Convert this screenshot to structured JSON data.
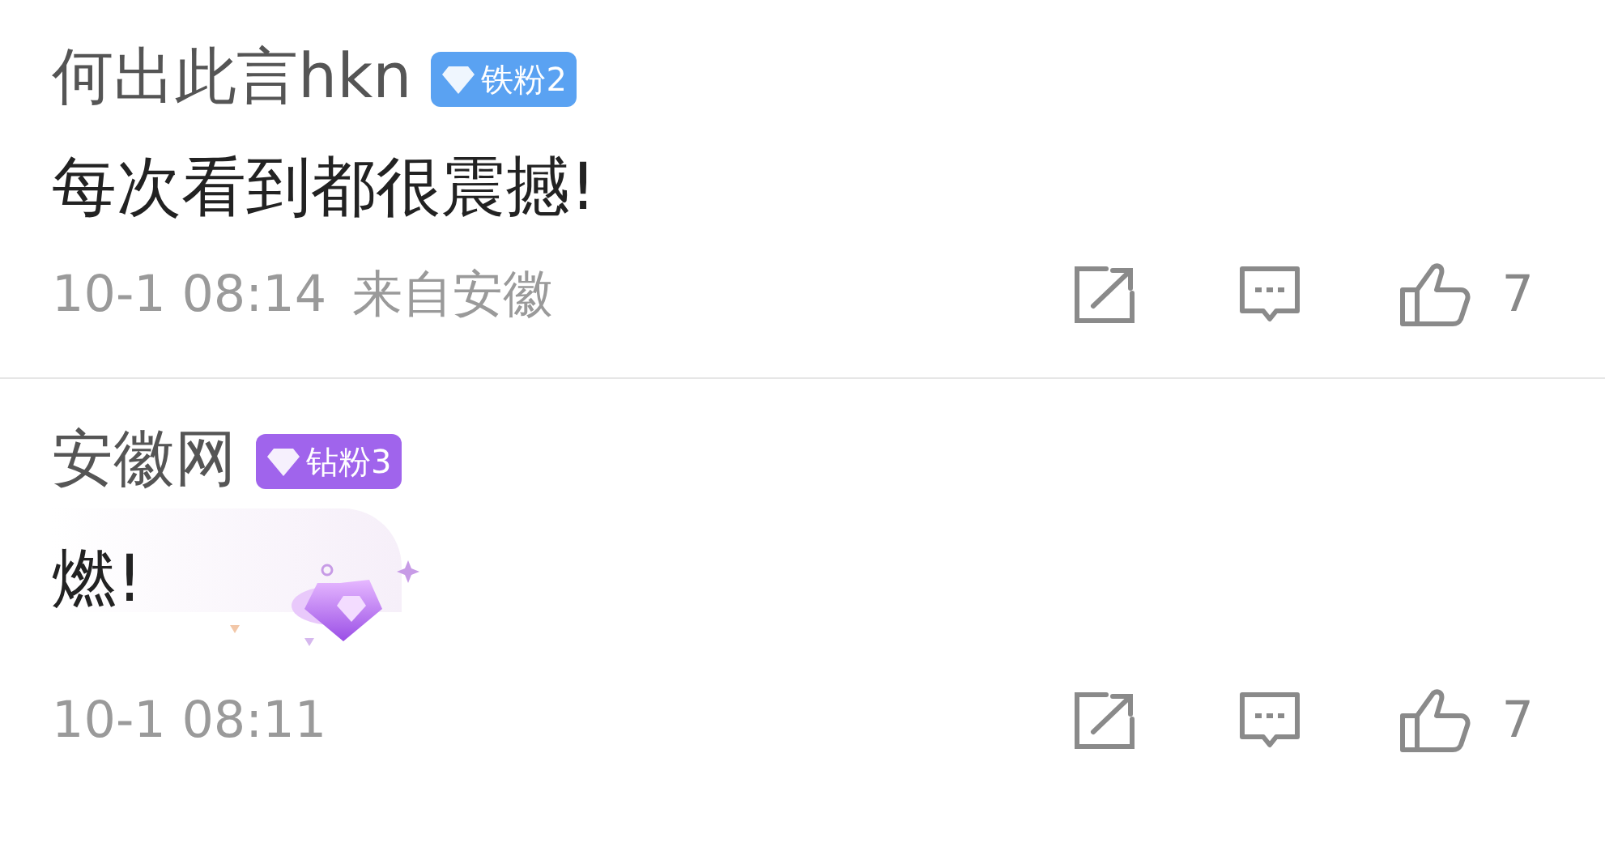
{
  "comments": [
    {
      "author": "何出此言hkn",
      "badge": {
        "label": "铁粉2",
        "color": "#5aa2f2"
      },
      "text": "每次看到都很震撼!",
      "bubble": false,
      "time": "10-1 08:14",
      "location": "来自安徽",
      "likes": "7"
    },
    {
      "author": "安徽网",
      "badge": {
        "label": "钻粉3",
        "color": "#a064ec"
      },
      "text": "燃!",
      "bubble": true,
      "time": "10-1 08:11",
      "likes": "7"
    }
  ]
}
